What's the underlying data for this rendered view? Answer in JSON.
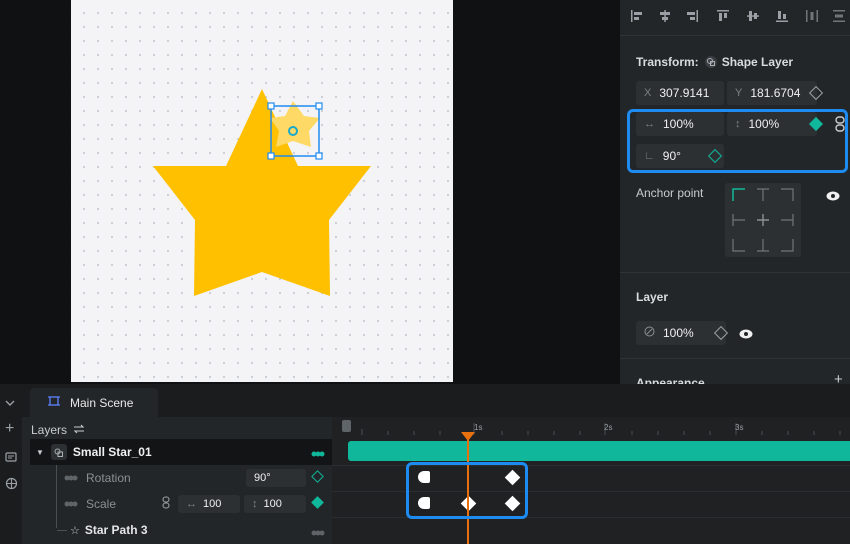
{
  "transform": {
    "title": "Transform:",
    "layer_type": "Shape Layer",
    "x_label": "X",
    "x_value": "307.9141",
    "y_label": "Y",
    "y_value": "181.6704",
    "width_value": "100%",
    "height_value": "100%",
    "rotation_value": "90°"
  },
  "anchor": {
    "label": "Anchor point"
  },
  "layer_section": {
    "title": "Layer",
    "opacity": "100%"
  },
  "appearance": {
    "title": "Appearance"
  },
  "tabs": {
    "main_scene": "Main Scene"
  },
  "layers_panel": {
    "title": "Layers"
  },
  "layers": {
    "small_star": "Small Star_01",
    "rotation_label": "Rotation",
    "rotation_value": "90°",
    "scale_label": "Scale",
    "scale_w": "100",
    "scale_h": "100",
    "star_path": "Star Path 3"
  },
  "ruler": {
    "t1": "1s",
    "t2": "2s",
    "t3": "3s"
  },
  "colors": {
    "accent_teal": "#10b79a",
    "selection_blue": "#1e8bf0",
    "star_yellow": "#ffc000",
    "playhead": "#e8700f"
  },
  "icons": [
    "align-left-icon",
    "align-center-icon",
    "align-right-icon",
    "align-top-icon",
    "align-middle-icon",
    "align-bottom-icon",
    "distribute-horizontal-icon",
    "distribute-vertical-icon",
    "shape-layer-icon",
    "keyframe-icon",
    "link-icon",
    "angle-icon",
    "eye-icon",
    "opacity-icon",
    "plus-icon",
    "chevron-down-icon",
    "scene-icon",
    "swap-icon",
    "star-icon"
  ]
}
